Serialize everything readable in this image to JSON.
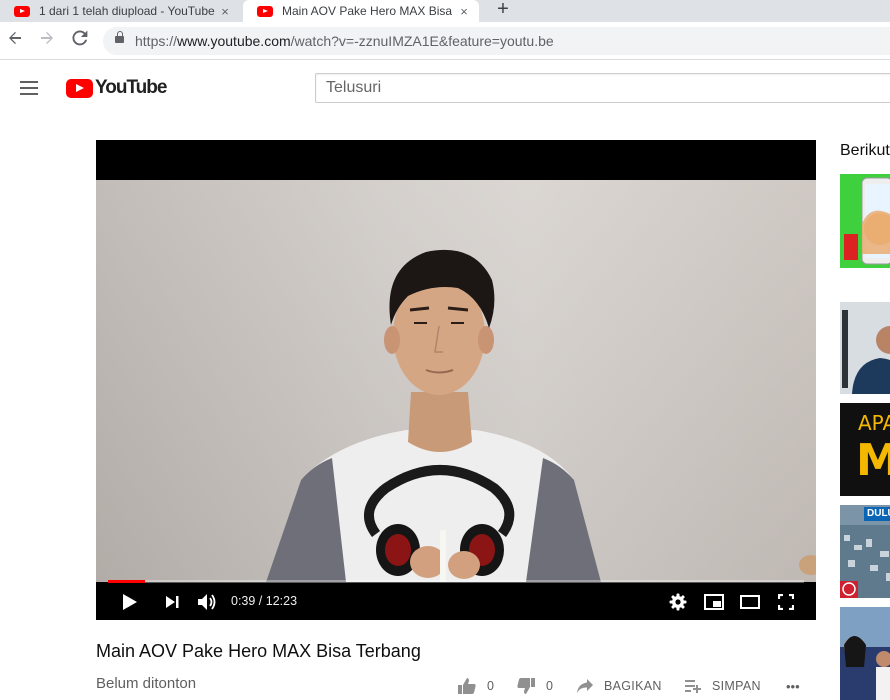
{
  "browser": {
    "tabs": [
      {
        "title": "1 dari 1 telah diupload - YouTube",
        "active": false,
        "icon": "youtube-favicon"
      },
      {
        "title": "Main AOV Pake Hero MAX Bisa Terbang - YouTube",
        "active": true,
        "icon": "youtube-favicon"
      }
    ],
    "new_tab_label": "+",
    "close_glyph": "×",
    "url_scheme": "https://",
    "url_host": "www.youtube.com",
    "url_path": "/watch?v=-zznuIMZA1E&feature=youtu.be"
  },
  "masthead": {
    "logo_text": "YouTube",
    "search_placeholder": "Telusuri"
  },
  "player": {
    "current_time": "0:39",
    "duration": "12:23",
    "time_display": "0:39 / 12:23",
    "progress_fraction": 0.0525,
    "buffered_fraction": 0.0525
  },
  "video": {
    "title": "Main AOV Pake Hero MAX Bisa Terbang",
    "watch_status": "Belum ditonton",
    "likes": "0",
    "dislikes": "0",
    "share_label": "BAGIKAN",
    "save_label": "SIMPAN",
    "more_label": "•••"
  },
  "sidebar": {
    "up_next_label": "Berikut",
    "thumbnails": [
      {
        "icon": "phone-thumbnail",
        "accent": "#36d23a"
      },
      {
        "icon": "person-thumbnail",
        "accent": "#1d3a5c"
      },
      {
        "icon": "text-thumbnail",
        "text": "APA",
        "big": "M",
        "accent": "#f5b800"
      },
      {
        "icon": "city-thumbnail",
        "text": "DULU",
        "accent": "#0a66b5"
      },
      {
        "icon": "crowd-thumbnail",
        "accent": "#2a3b6e"
      }
    ]
  },
  "colors": {
    "brand_red": "#ff0000",
    "progress_red": "#ff0000",
    "text_primary": "#0f0f0f",
    "text_secondary": "#606060"
  }
}
